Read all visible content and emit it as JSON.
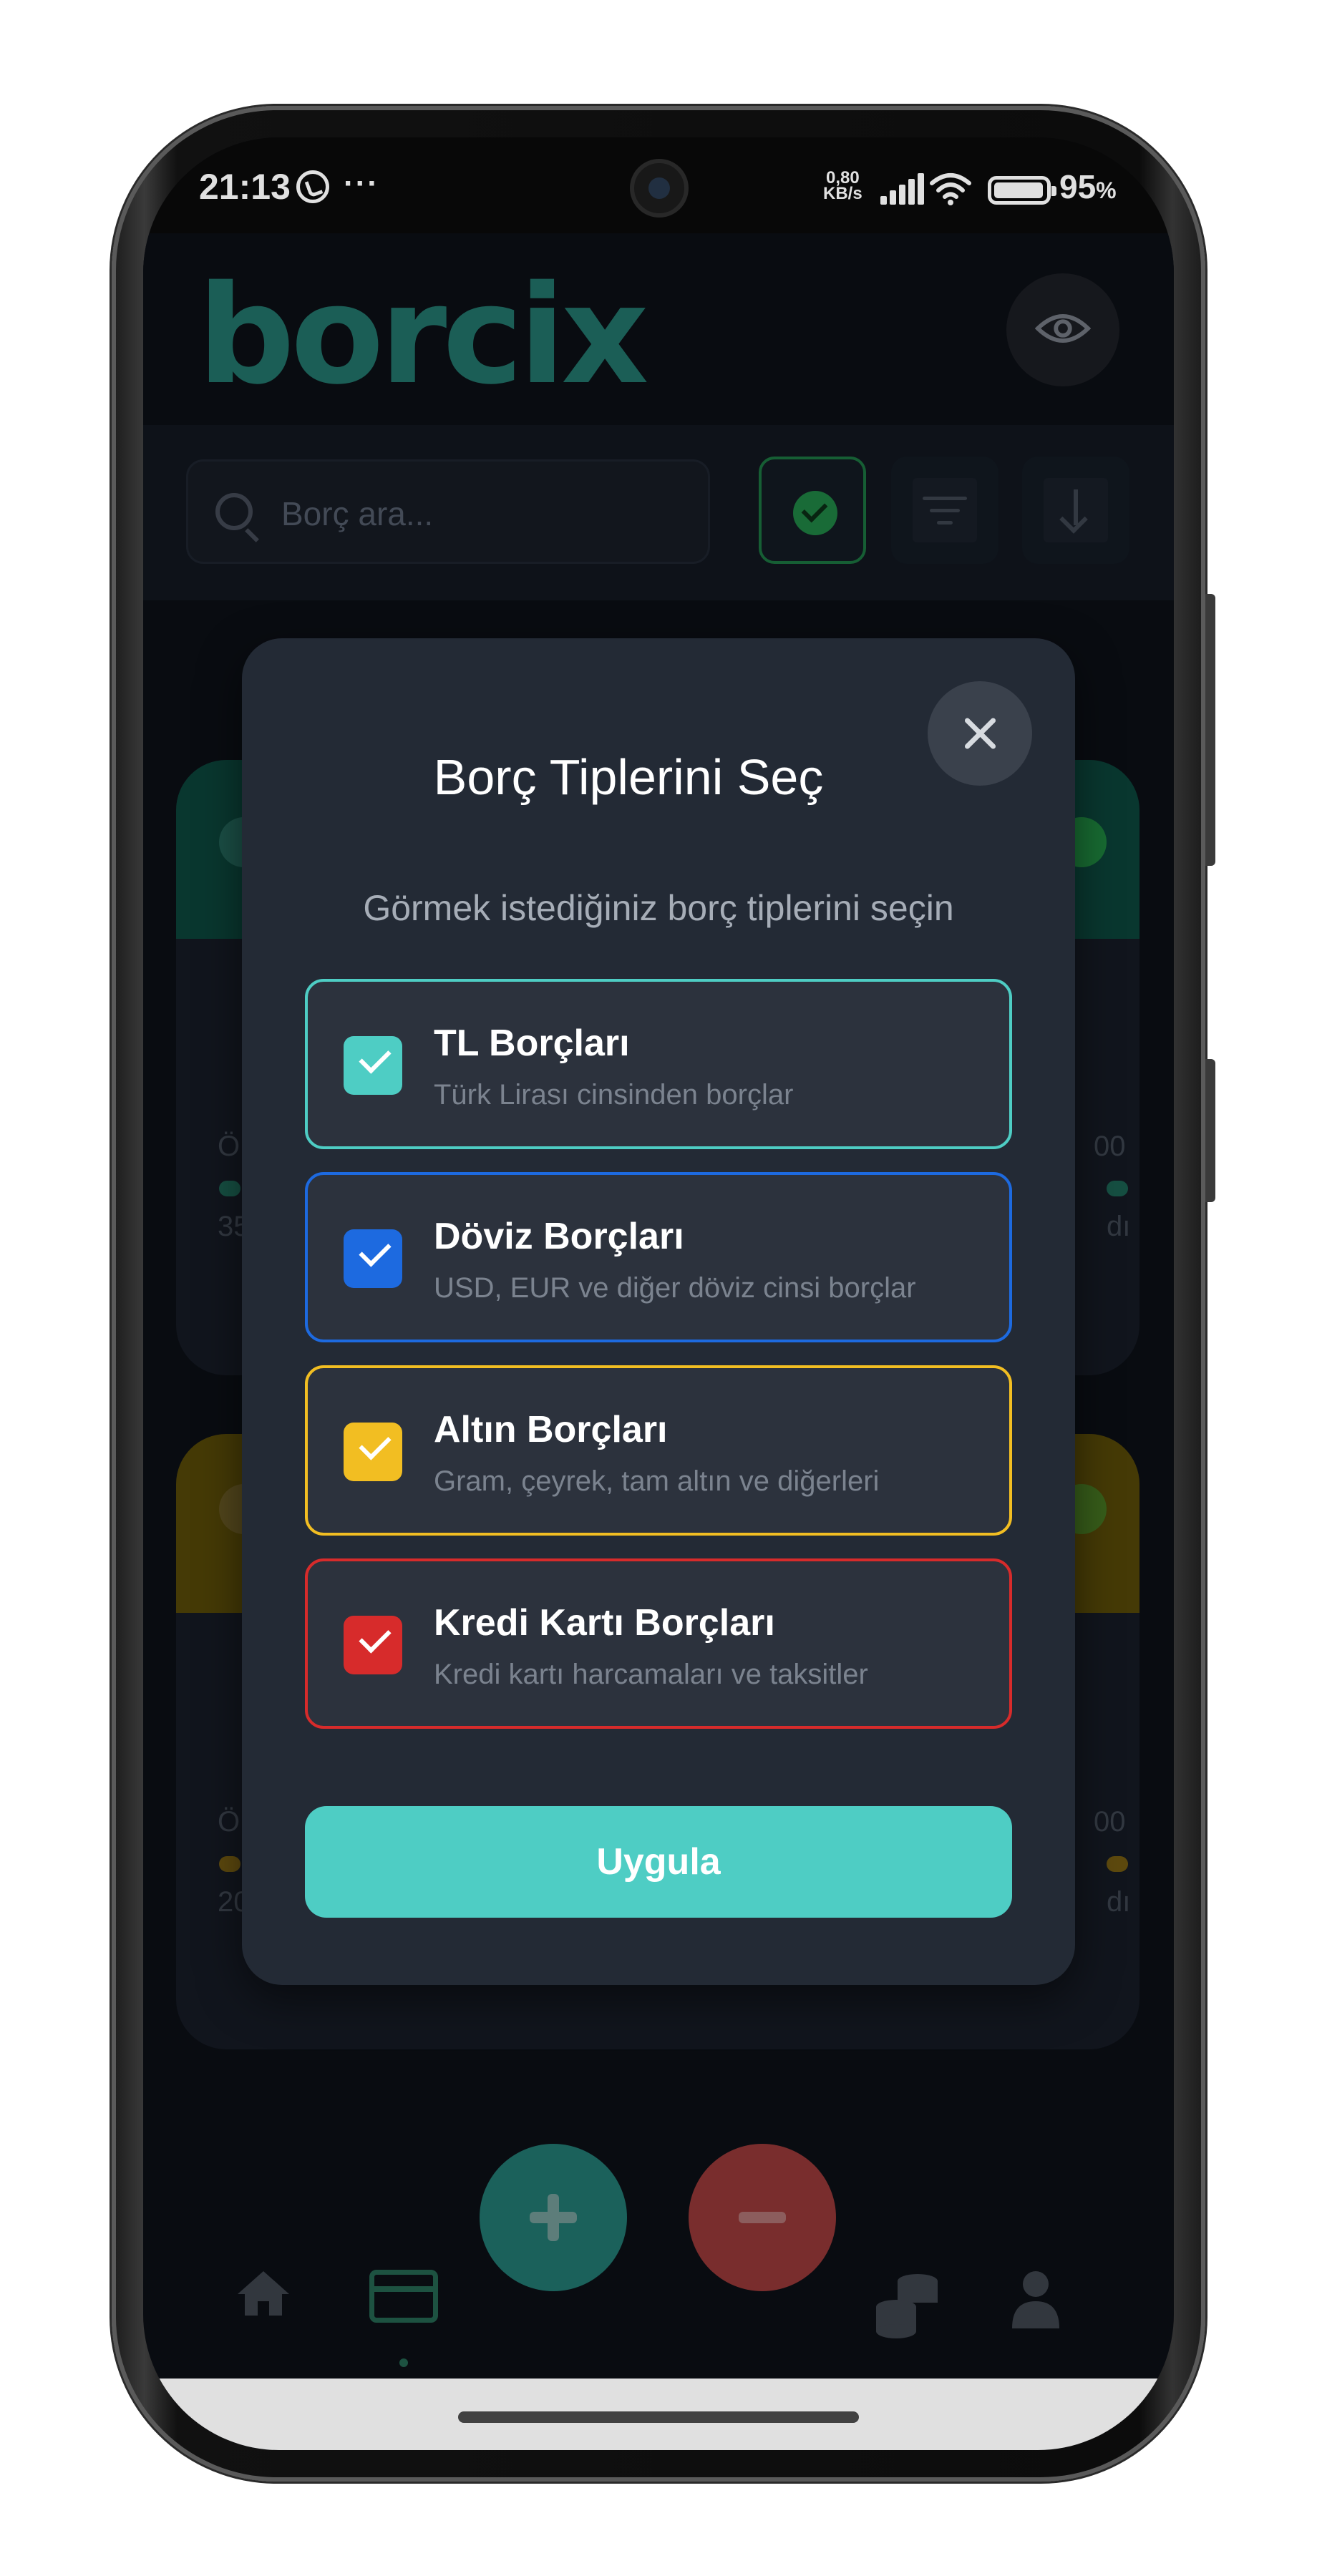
{
  "status_bar": {
    "time": "21:13",
    "net_speed_value": "0,80",
    "net_speed_unit": "KB/s",
    "battery": "95",
    "battery_unit": "%"
  },
  "app": {
    "logo": "borcix",
    "search": {
      "placeholder": "Borç ara..."
    },
    "bg_fragments": [
      "Ö",
      "35",
      "00",
      "dı",
      "Ö",
      "20",
      "00",
      "dı"
    ]
  },
  "modal": {
    "title": "Borç Tiplerini Seç",
    "subtitle": "Görmek istediğiniz borç tiplerini seçin",
    "options": [
      {
        "title": "TL Borçları",
        "description": "Türk Lirası cinsinden borçlar",
        "checked": true,
        "color": "#4ecdc4"
      },
      {
        "title": "Döviz Borçları",
        "description": "USD, EUR ve diğer döviz cinsi borçlar",
        "checked": true,
        "color": "#1d6ae0"
      },
      {
        "title": "Altın Borçları",
        "description": "Gram, çeyrek, tam altın ve diğerleri",
        "checked": true,
        "color": "#f2be22"
      },
      {
        "title": "Kredi Kartı Borçları",
        "description": "Kredi kartı harcamaları ve taksitler",
        "checked": true,
        "color": "#d72b2b"
      }
    ],
    "apply_label": "Uygula"
  },
  "colors": {
    "accent": "#4ecdc4",
    "modal_bg": "#232a35",
    "screen_bg": "#0b0e14"
  },
  "icons": {
    "close": "close-icon",
    "search": "search-icon",
    "eye": "eye-icon",
    "check": "check-icon",
    "home": "home-icon",
    "card": "credit-card-icon",
    "coins": "coins-icon",
    "user": "user-icon"
  }
}
